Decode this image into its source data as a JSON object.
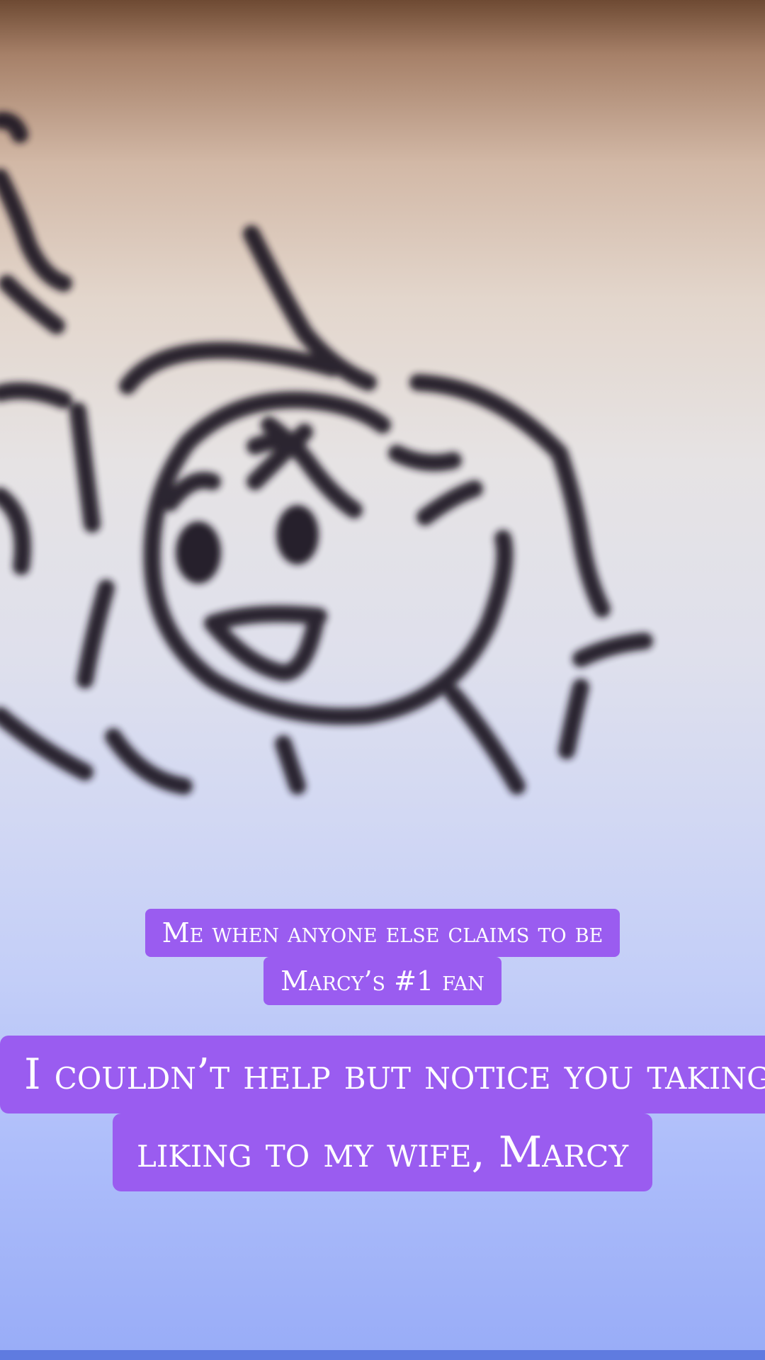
{
  "captions": {
    "small": {
      "line1": "Me when anyone else claims to be",
      "line2": "Marcy’s #1 fan"
    },
    "large": {
      "line1": "I couldn’t help but notice you taking a",
      "line2": "liking to my wife, Marcy"
    }
  },
  "colors": {
    "caption_bg": "#9a5cf0",
    "caption_text": "#ffffff",
    "sketch_ink": "#1e1522"
  }
}
